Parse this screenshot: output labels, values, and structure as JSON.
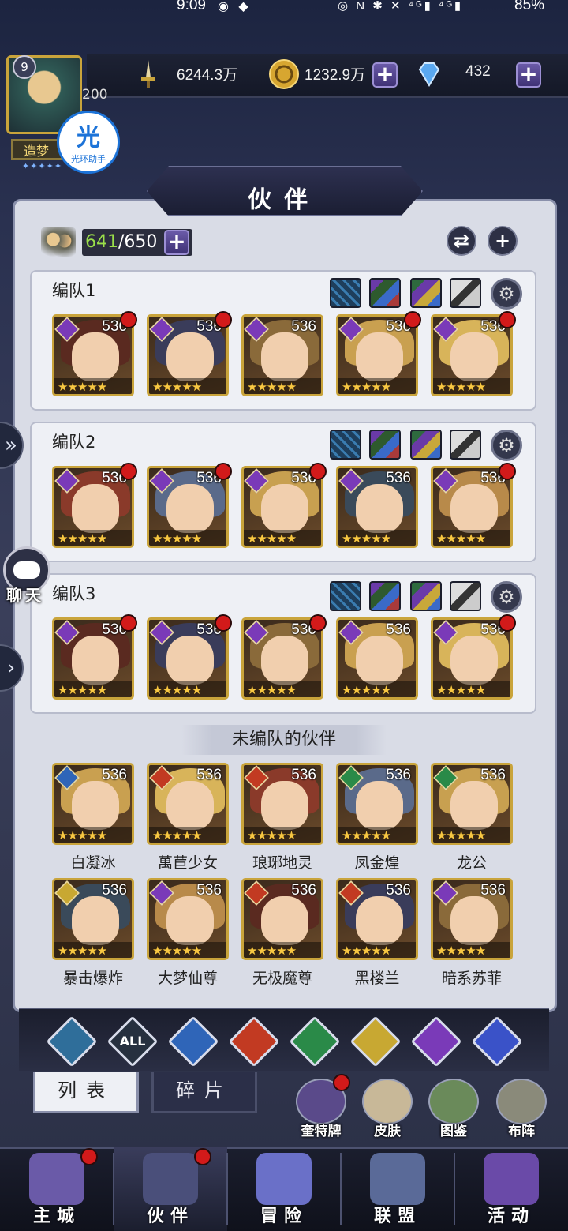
{
  "status_bar": {
    "time": "9:09",
    "left_icons": "◉ ◆",
    "right_icons": "◎ N ✱ ✕ ⁴ᴳ▮ ⁴ᴳ▮",
    "battery": "85%"
  },
  "player": {
    "level": "9",
    "points": "200",
    "title": "造梦",
    "stars": "✦✦✦✦✦"
  },
  "helper_badge": {
    "glyph": "光",
    "label": "光环助手"
  },
  "resources": {
    "power": "6244.3万",
    "gold": "1232.9万",
    "diamonds": "432",
    "plus": "+"
  },
  "page": {
    "title": "伙伴"
  },
  "partner_count": {
    "current": "641",
    "max": "/650",
    "plus": "+"
  },
  "teams": [
    {
      "label": "编队1",
      "heroes": [
        {
          "lvl": "536",
          "stars": "★★★★★",
          "dot": true
        },
        {
          "lvl": "536",
          "stars": "★★★★★",
          "dot": true
        },
        {
          "lvl": "536",
          "stars": "★★★★★",
          "dot": false
        },
        {
          "lvl": "536",
          "stars": "★★★★★",
          "dot": true
        },
        {
          "lvl": "536",
          "stars": "★★★★★",
          "dot": true
        }
      ]
    },
    {
      "label": "编队2",
      "heroes": [
        {
          "lvl": "536",
          "stars": "★★★★★",
          "dot": true
        },
        {
          "lvl": "536",
          "stars": "★★★★★",
          "dot": true
        },
        {
          "lvl": "536",
          "stars": "★★★★★",
          "dot": true
        },
        {
          "lvl": "536",
          "stars": "★★★★★",
          "dot": false
        },
        {
          "lvl": "536",
          "stars": "★★★★★",
          "dot": true
        }
      ]
    },
    {
      "label": "编队3",
      "heroes": [
        {
          "lvl": "536",
          "stars": "★★★★★",
          "dot": true
        },
        {
          "lvl": "536",
          "stars": "★★★★★",
          "dot": true
        },
        {
          "lvl": "536",
          "stars": "★★★★★",
          "dot": true
        },
        {
          "lvl": "536",
          "stars": "★★★★★",
          "dot": false
        },
        {
          "lvl": "536",
          "stars": "★★★★★",
          "dot": true
        }
      ]
    }
  ],
  "unassigned": {
    "header": "未编队的伙伴",
    "heroes": [
      {
        "name": "白凝冰",
        "lvl": "536",
        "stars": "★★★★★",
        "element": "water"
      },
      {
        "name": "萬苣少女",
        "lvl": "536",
        "stars": "★★★★★",
        "element": "fire"
      },
      {
        "name": "琅琊地灵",
        "lvl": "536",
        "stars": "★★★★★",
        "element": "fire"
      },
      {
        "name": "凤金煌",
        "lvl": "536",
        "stars": "★★★★★",
        "element": "wind"
      },
      {
        "name": "龙公",
        "lvl": "536",
        "stars": "★★★★★",
        "element": "wind"
      },
      {
        "name": "暴击爆炸",
        "lvl": "536",
        "stars": "★★★★★",
        "element": "light"
      },
      {
        "name": "大梦仙尊",
        "lvl": "536",
        "stars": "★★★★★",
        "element": "moon"
      },
      {
        "name": "无极魔尊",
        "lvl": "536",
        "stars": "★★★★★",
        "element": "fire"
      },
      {
        "name": "黑楼兰",
        "lvl": "536",
        "stars": "★★★★★",
        "element": "fire"
      },
      {
        "name": "暗系苏菲",
        "lvl": "536",
        "stars": "★★★★★",
        "element": "moon"
      }
    ]
  },
  "filters": [
    {
      "label": "",
      "icon": "chevron-up-icon",
      "color": "#2f6e9a"
    },
    {
      "label": "ALL",
      "icon": "all-icon",
      "color": "#26303f"
    },
    {
      "label": "",
      "icon": "water-drop-icon",
      "color": "#2f65b8"
    },
    {
      "label": "",
      "icon": "flame-icon",
      "color": "#c23a22"
    },
    {
      "label": "",
      "icon": "wind-icon",
      "color": "#2a8a48"
    },
    {
      "label": "",
      "icon": "sun-icon",
      "color": "#c8a832"
    },
    {
      "label": "",
      "icon": "moon-icon",
      "color": "#7a3ab8"
    },
    {
      "label": "",
      "icon": "planet-icon",
      "color": "#3a52c8"
    }
  ],
  "tabs": {
    "list": "列表",
    "fragments": "碎片"
  },
  "side_buttons": [
    {
      "label": "奎特牌",
      "badge": true
    },
    {
      "label": "皮肤",
      "badge": false
    },
    {
      "label": "图鉴",
      "badge": false
    },
    {
      "label": "布阵",
      "badge": false
    }
  ],
  "chat": {
    "label": "聊天"
  },
  "nav": [
    {
      "label": "主城",
      "badge": true
    },
    {
      "label": "伙伴",
      "badge": true
    },
    {
      "label": "冒险",
      "badge": false
    },
    {
      "label": "联盟",
      "badge": false
    },
    {
      "label": "活动",
      "badge": false
    }
  ],
  "colors": {
    "accent_gold": "#c9a43b",
    "badge_red": "#d21a1a",
    "count_green": "#9be04a",
    "panel_bg": "#d9dce6"
  }
}
